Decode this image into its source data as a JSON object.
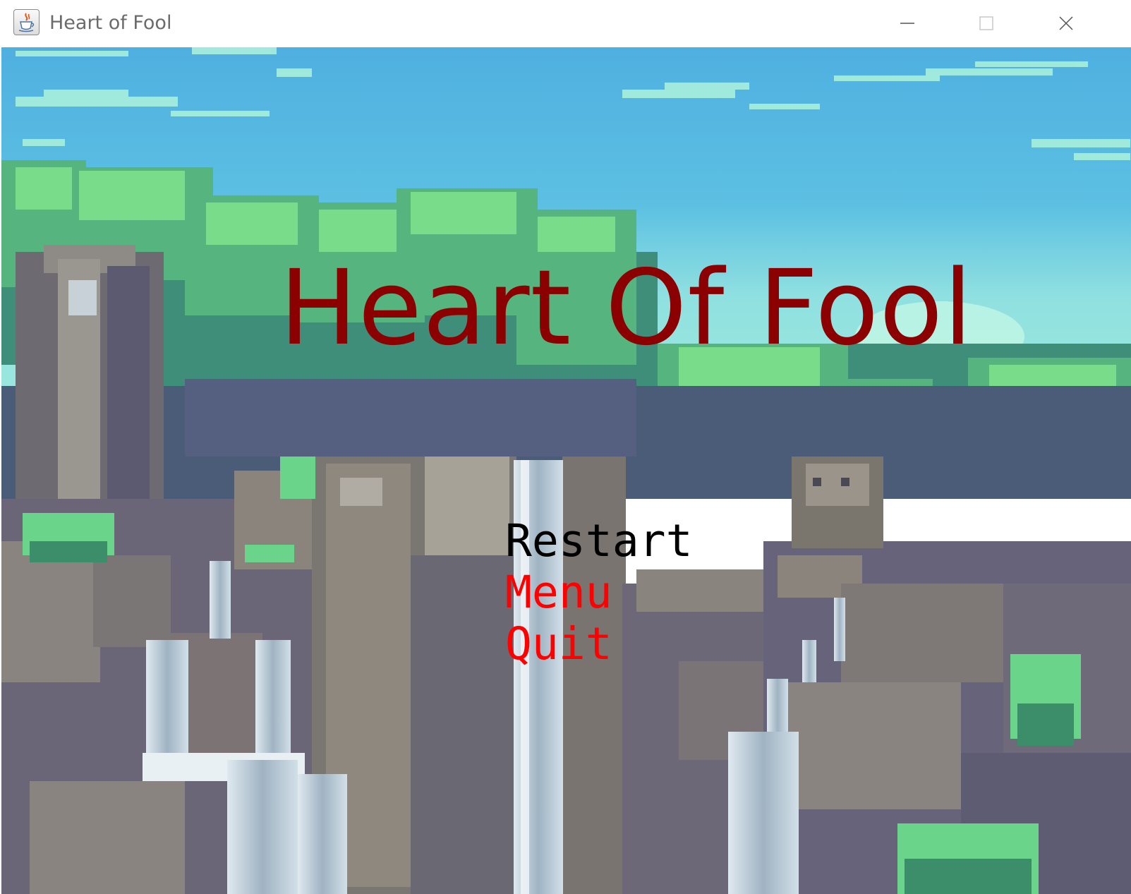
{
  "window": {
    "title": "Heart of Fool",
    "icon": "java-cup-icon",
    "controls": [
      "minimize-icon",
      "maximize-icon",
      "close-icon"
    ]
  },
  "game": {
    "title": "Heart Of Fool",
    "title_color": "#8b0000",
    "menu": [
      {
        "label": "Restart",
        "color": "#000000",
        "selected": true
      },
      {
        "label": "Menu",
        "color": "#ff0000",
        "selected": false
      },
      {
        "label": "Quit",
        "color": "#ff0000",
        "selected": false
      }
    ]
  }
}
